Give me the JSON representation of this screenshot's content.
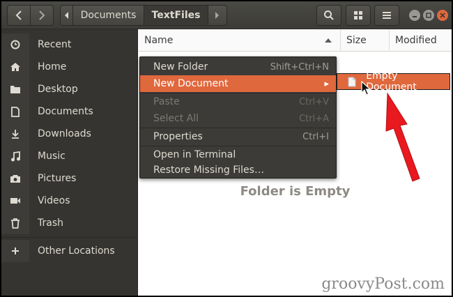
{
  "path": [
    "Documents",
    "TextFiles"
  ],
  "sidebar": {
    "items": [
      {
        "label": "Recent",
        "icon": "clock-icon"
      },
      {
        "label": "Home",
        "icon": "home-icon"
      },
      {
        "label": "Desktop",
        "icon": "folder-icon"
      },
      {
        "label": "Documents",
        "icon": "document-icon"
      },
      {
        "label": "Downloads",
        "icon": "download-icon"
      },
      {
        "label": "Music",
        "icon": "music-icon"
      },
      {
        "label": "Pictures",
        "icon": "camera-icon"
      },
      {
        "label": "Videos",
        "icon": "video-icon"
      },
      {
        "label": "Trash",
        "icon": "trash-icon"
      }
    ],
    "other_locations": "Other Locations"
  },
  "columns": {
    "name": "Name",
    "size": "Size",
    "modified": "Modified"
  },
  "empty_message": "Folder is Empty",
  "context_menu": {
    "items": [
      {
        "label": "New Folder",
        "shortcut": "Shift+Ctrl+N"
      },
      {
        "label": "New Document",
        "shortcut": "▸"
      },
      {
        "label": "Paste",
        "shortcut": "Ctrl+V"
      },
      {
        "label": "Select All",
        "shortcut": "Ctrl+A"
      },
      {
        "label": "Properties",
        "shortcut": "Ctrl+I"
      },
      {
        "label": "Open in Terminal",
        "shortcut": ""
      },
      {
        "label": "Restore Missing Files…",
        "shortcut": ""
      }
    ]
  },
  "submenu": {
    "label": "Empty Document"
  },
  "watermark": "groovyPost.com",
  "colors": {
    "accent": "#e0683d",
    "annotation_arrow": "#e8191f",
    "sidebar_bg": "#353430",
    "headerbar_bg": "#3c3b37"
  }
}
